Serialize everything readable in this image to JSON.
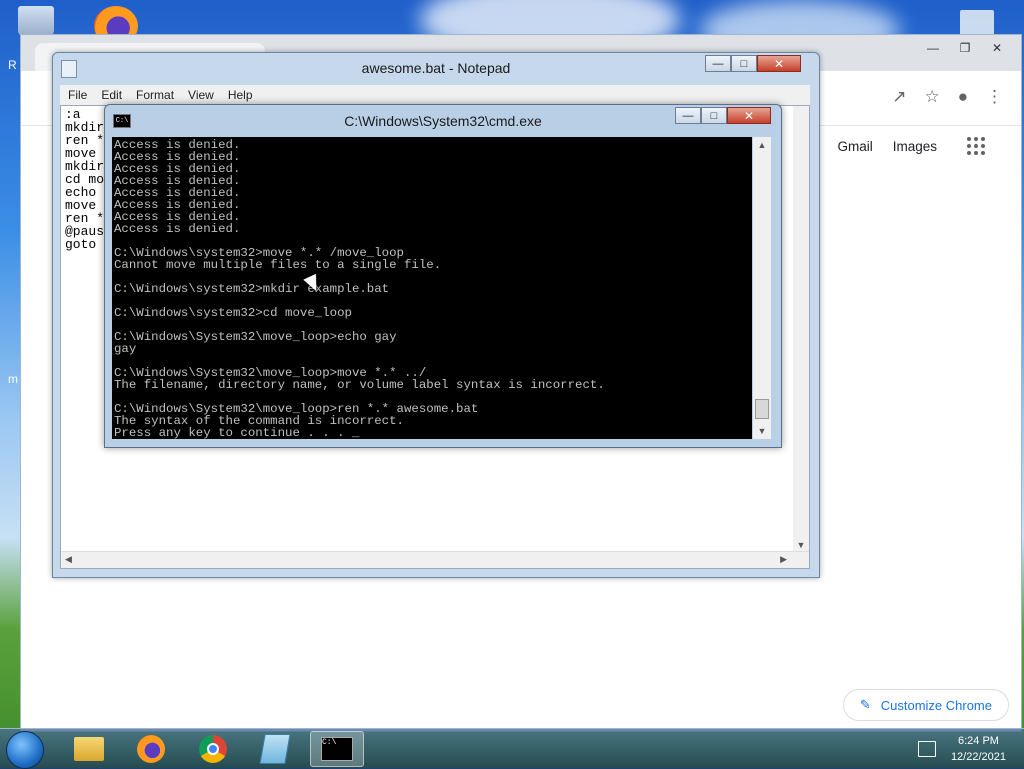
{
  "desktop": {
    "left_letters": [
      "R",
      "m"
    ]
  },
  "chrome": {
    "header_links": [
      "Gmail",
      "Images"
    ],
    "customize_label": "Customize Chrome"
  },
  "notepad": {
    "title": "awesome.bat - Notepad",
    "menu": [
      "File",
      "Edit",
      "Format",
      "View",
      "Help"
    ],
    "lines": [
      ":a",
      "mkdir",
      "ren *",
      "move",
      "mkdir",
      "cd mo",
      "echo",
      "move",
      "ren *",
      "@paus",
      "goto"
    ]
  },
  "cmd": {
    "title": "C:\\Windows\\System32\\cmd.exe",
    "icon_label": "C:\\",
    "lines": [
      "Access is denied.",
      "Access is denied.",
      "Access is denied.",
      "Access is denied.",
      "Access is denied.",
      "Access is denied.",
      "Access is denied.",
      "Access is denied.",
      "",
      "C:\\Windows\\system32>move *.* /move_loop",
      "Cannot move multiple files to a single file.",
      "",
      "C:\\Windows\\system32>mkdir example.bat",
      "",
      "C:\\Windows\\system32>cd move_loop",
      "",
      "C:\\Windows\\System32\\move_loop>echo gay",
      "gay",
      "",
      "C:\\Windows\\System32\\move_loop>move *.* ../",
      "The filename, directory name, or volume label syntax is incorrect.",
      "",
      "C:\\Windows\\System32\\move_loop>ren *.* awesome.bat",
      "The syntax of the command is incorrect.",
      "Press any key to continue . . . _"
    ]
  },
  "taskbar": {
    "time": "6:24 PM",
    "date": "12/22/2021"
  }
}
